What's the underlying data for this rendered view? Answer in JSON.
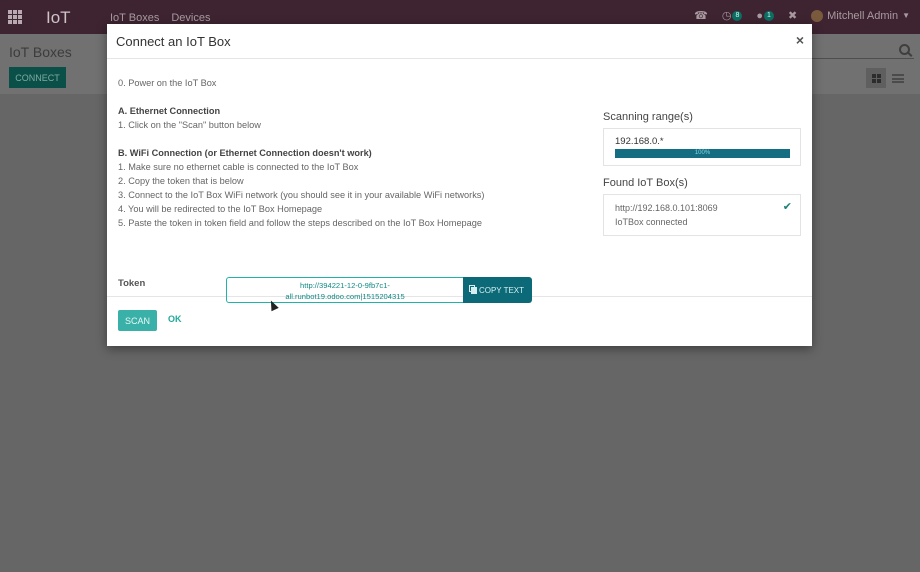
{
  "navbar": {
    "app_name": "IoT",
    "menu": [
      "IoT Boxes",
      "Devices"
    ],
    "activity_badge": "8",
    "messages_badge": "1",
    "user_name": "Mitchell Admin"
  },
  "control_panel": {
    "title": "IoT Boxes",
    "connect_label": "CONNECT"
  },
  "modal": {
    "title": "Connect an IoT Box",
    "close_symbol": "×",
    "steps": {
      "power": "0. Power on the IoT Box",
      "ethernet_heading": "A. Ethernet Connection",
      "ethernet_steps": [
        "1. Click on the \"Scan\" button below"
      ],
      "wifi_heading": "B. WiFi Connection (or Ethernet Connection doesn't work)",
      "wifi_steps": [
        "1. Make sure no ethernet cable is connected to the IoT Box",
        "2. Copy the token that is below",
        "3. Connect to the IoT Box WiFi network (you should see it in your available WiFi networks)",
        "4. You will be redirected to the IoT Box Homepage",
        "5. Paste the token in token field and follow the steps described on the IoT Box Homepage"
      ]
    },
    "token": {
      "label": "Token",
      "line1": "http://394221-12-0-9fb7c1-",
      "line2": "all.runbot19.odoo.com|1515204315",
      "copy_label": "COPY TEXT"
    },
    "scanning": {
      "title": "Scanning range(s)",
      "range": "192.168.0.*",
      "progress_percent": 100,
      "progress_label": "100%"
    },
    "found": {
      "title": "Found IoT Box(s)",
      "url": "http://192.168.0.101:8069",
      "status": "IoTBox connected",
      "check_symbol": "✔"
    },
    "footer": {
      "scan_label": "SCAN",
      "ok_label": "OK"
    }
  },
  "colors": {
    "navbar": "#3d2430",
    "primary": "#3ab1a8",
    "copy_button": "#0c6a78",
    "progress": "#146d81"
  }
}
